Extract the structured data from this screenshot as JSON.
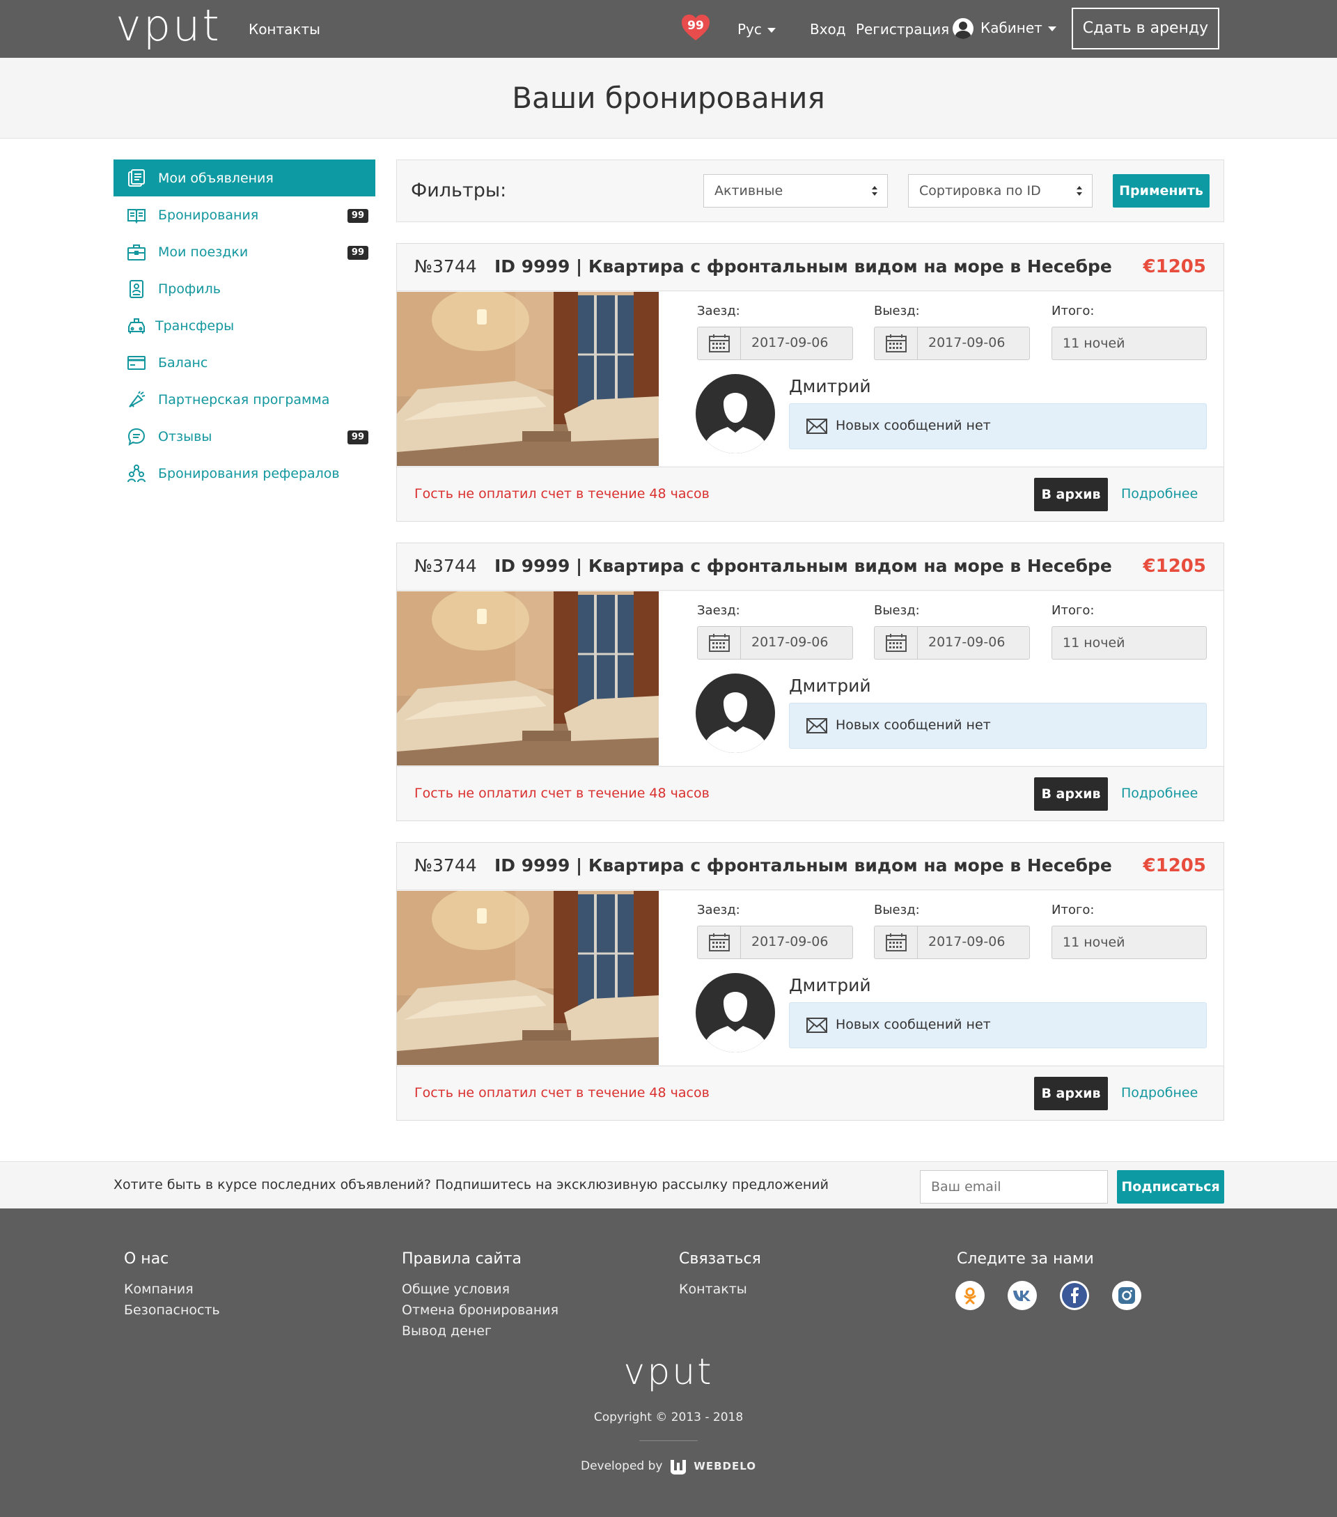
{
  "header": {
    "logo": "vput",
    "contacts": "Контакты",
    "favorites_count": "99",
    "language": "Рус",
    "login": "Вход",
    "register": "Регистрация",
    "cabinet": "Кабинет",
    "rent_button": "Сдать в аренду"
  },
  "page_title": "Ваши бронирования",
  "sidebar": {
    "items": [
      {
        "label": "Мои объявления",
        "icon": "listings-icon",
        "badge": "",
        "active": true
      },
      {
        "label": "Бронирования",
        "icon": "book-icon",
        "badge": "99"
      },
      {
        "label": "Мои поездки",
        "icon": "suitcase-icon",
        "badge": "99"
      },
      {
        "label": "Профиль",
        "icon": "profile-icon",
        "badge": ""
      },
      {
        "label": "Трансферы",
        "icon": "taxi-icon",
        "badge": ""
      },
      {
        "label": "Баланс",
        "icon": "card-icon",
        "badge": ""
      },
      {
        "label": "Партнерская программа",
        "icon": "megaphone-icon",
        "badge": ""
      },
      {
        "label": "Отзывы",
        "icon": "chat-icon",
        "badge": "99"
      },
      {
        "label": "Бронирования рефералов",
        "icon": "referrals-icon",
        "badge": ""
      }
    ]
  },
  "filters": {
    "label": "Фильтры:",
    "status_value": "Активные",
    "sort_value": "Сортировка по ID",
    "apply": "Применить"
  },
  "bookings": [
    {
      "number": "№3744",
      "title": "ID 9999 | Квартира с фронтальным видом на море в Несебре",
      "price": "€1205",
      "checkin_label": "Заезд:",
      "checkin": "2017-09-06",
      "checkout_label": "Выезд:",
      "checkout": "2017-09-06",
      "total_label": "Итого:",
      "total": "11 ночей",
      "guest": "Дмитрий",
      "messages": "Новых сообщений нет",
      "warning": "Гость не оплатил счет в течение 48 часов",
      "archive": "В архив",
      "more": "Подробнее"
    },
    {
      "number": "№3744",
      "title": "ID 9999 | Квартира с фронтальным видом на море в Несебре",
      "price": "€1205",
      "checkin_label": "Заезд:",
      "checkin": "2017-09-06",
      "checkout_label": "Выезд:",
      "checkout": "2017-09-06",
      "total_label": "Итого:",
      "total": "11 ночей",
      "guest": "Дмитрий",
      "messages": "Новых сообщений нет",
      "warning": "Гость не оплатил счет в течение 48 часов",
      "archive": "В архив",
      "more": "Подробнее"
    },
    {
      "number": "№3744",
      "title": "ID 9999 | Квартира с фронтальным видом на море в Несебре",
      "price": "€1205",
      "checkin_label": "Заезд:",
      "checkin": "2017-09-06",
      "checkout_label": "Выезд:",
      "checkout": "2017-09-06",
      "total_label": "Итого:",
      "total": "11 ночей",
      "guest": "Дмитрий",
      "messages": "Новых сообщений нет",
      "warning": "Гость не оплатил счет в течение 48 часов",
      "archive": "В архив",
      "more": "Подробнее"
    }
  ],
  "subscribe": {
    "text": "Хотите быть в курсе последних объявлений? Подпишитесь на эксклюзивную рассылку предложений",
    "placeholder": "Ваш email",
    "button": "Подписаться"
  },
  "footer": {
    "about": {
      "title": "О нас",
      "links": [
        "Компания",
        "Безопасность"
      ]
    },
    "rules": {
      "title": "Правила сайта",
      "links": [
        "Общие условия",
        "Отмена бронирования",
        "Вывод денег"
      ]
    },
    "contact": {
      "title": "Связаться",
      "links": [
        "Контакты"
      ]
    },
    "follow": {
      "title": "Следите за нами",
      "icons": [
        "odnoklassniki-icon",
        "vk-icon",
        "facebook-icon",
        "instagram-icon"
      ]
    },
    "logo": "vput",
    "copyright": "Copyright © 2013 - 2018",
    "developed_by": "Developed by",
    "developer": "WEBDELO"
  },
  "colors": {
    "header_bg": "#5e5e5e",
    "accent": "#0d9aa2",
    "price": "#e74c3c",
    "warning": "#d9302f",
    "favorites": "#e84c4c"
  }
}
